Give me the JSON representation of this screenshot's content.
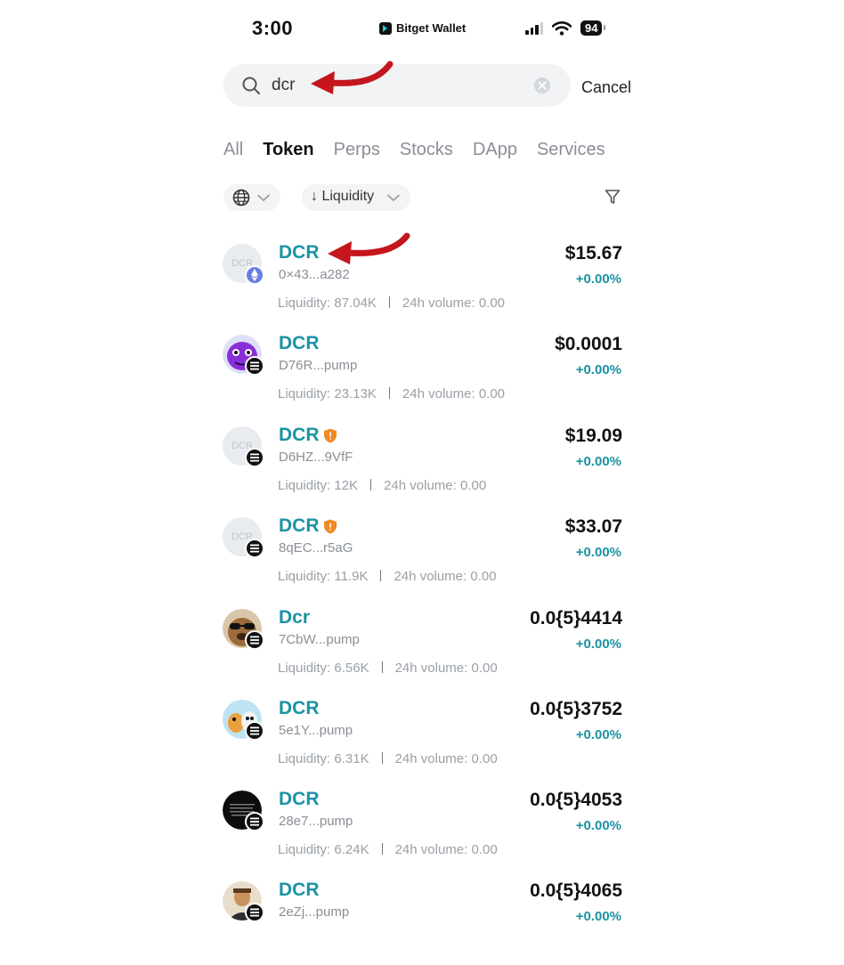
{
  "status_bar": {
    "time": "3:00",
    "app_name": "Bitget Wallet",
    "battery": "94"
  },
  "search": {
    "query": "dcr",
    "placeholder": "",
    "cancel_label": "Cancel"
  },
  "tabs": [
    {
      "label": "All",
      "active": false
    },
    {
      "label": "Token",
      "active": true
    },
    {
      "label": "Perps",
      "active": false
    },
    {
      "label": "Stocks",
      "active": false
    },
    {
      "label": "DApp",
      "active": false
    },
    {
      "label": "Services",
      "active": false
    }
  ],
  "filters": {
    "sort_label": "↓ Liquidity"
  },
  "meta_labels": {
    "liquidity": "Liquidity: ",
    "volume": "24h volume: "
  },
  "tokens": [
    {
      "symbol": "DCR",
      "address": "0×43...a282",
      "liquidity": "87.04K",
      "volume": "0.00",
      "price": "$15.67",
      "change": "+0.00%",
      "avatar": "placeholder",
      "avatar_text": "DCR",
      "chain": "eth-icon",
      "verified_badge": false
    },
    {
      "symbol": "DCR",
      "address": "D76R...pump",
      "liquidity": "23.13K",
      "volume": "0.00",
      "price": "$0.0001",
      "change": "+0.00%",
      "avatar": "purple-character",
      "chain": "solana-icon",
      "verified_badge": false
    },
    {
      "symbol": "DCR",
      "address": "D6HZ...9VfF",
      "liquidity": "12K",
      "volume": "0.00",
      "price": "$19.09",
      "change": "+0.00%",
      "avatar": "placeholder",
      "avatar_text": "DCR",
      "chain": "solana-icon",
      "verified_badge": true
    },
    {
      "symbol": "DCR",
      "address": "8qEC...r5aG",
      "liquidity": "11.9K",
      "volume": "0.00",
      "price": "$33.07",
      "change": "+0.00%",
      "avatar": "placeholder",
      "avatar_text": "DCR",
      "chain": "solana-icon",
      "verified_badge": true
    },
    {
      "symbol": "Dcr",
      "address": "7CbW...pump",
      "liquidity": "6.56K",
      "volume": "0.00",
      "price": "0.0{5}4414",
      "change": "+0.00%",
      "avatar": "dog-sunglasses",
      "chain": "solana-icon",
      "verified_badge": false
    },
    {
      "symbol": "DCR",
      "address": "5e1Y...pump",
      "liquidity": "6.31K",
      "volume": "0.00",
      "price": "0.0{5}3752",
      "change": "+0.00%",
      "avatar": "cartoon-cats",
      "chain": "solana-icon",
      "verified_badge": false
    },
    {
      "symbol": "DCR",
      "address": "28e7...pump",
      "liquidity": "6.24K",
      "volume": "0.00",
      "price": "0.0{5}4053",
      "change": "+0.00%",
      "avatar": "black-text",
      "chain": "solana-icon",
      "verified_badge": false
    },
    {
      "symbol": "DCR",
      "address": "2eZj...pump",
      "liquidity": "",
      "volume": "",
      "price": "0.0{5}4065",
      "change": "+0.00%",
      "avatar": "portrait",
      "chain": "solana-icon",
      "verified_badge": false
    }
  ],
  "colors": {
    "accent": "#1b93a4",
    "arrow": "#c4161c",
    "shield": "#f08a24"
  }
}
